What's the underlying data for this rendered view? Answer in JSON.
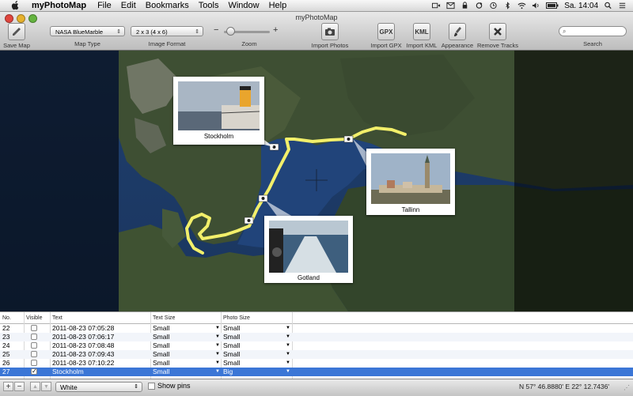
{
  "menubar": {
    "app_name": "myPhotoMap",
    "items": [
      "File",
      "Edit",
      "Bookmarks",
      "Tools",
      "Window",
      "Help"
    ],
    "clock": "Sa. 14:04"
  },
  "window": {
    "title": "myPhotoMap"
  },
  "toolbar": {
    "save_map": "Save Map",
    "map_type": {
      "label": "Map Type",
      "value": "NASA BlueMarble"
    },
    "image_format": {
      "label": "Image Format",
      "value": "2 x 3 (4 x 6)"
    },
    "zoom": {
      "label": "Zoom",
      "minus": "−",
      "plus": "+",
      "level": 0.15
    },
    "import_photos": "Import Photos",
    "import_gpx": "Import GPX",
    "gpx_icon_text": "GPX",
    "import_kml": "Import KML",
    "kml_icon_text": "KML",
    "appearance": "Appearance",
    "remove_tracks": "Remove Tracks",
    "search_label": "Search"
  },
  "map": {
    "photos": [
      {
        "caption": "Stockholm"
      },
      {
        "caption": "Tallinn"
      },
      {
        "caption": "Gotland"
      }
    ],
    "track_color": "#f2ef6a"
  },
  "table": {
    "headers": {
      "no": "No.",
      "visible": "Visible",
      "text": "Text",
      "text_size": "Text Size",
      "photo_size": "Photo Size"
    },
    "rows": [
      {
        "no": "22",
        "visible": false,
        "text": "2011-08-23 07:05:28",
        "text_size": "Small",
        "photo_size": "Small"
      },
      {
        "no": "23",
        "visible": false,
        "text": "2011-08-23 07:06:17",
        "text_size": "Small",
        "photo_size": "Small"
      },
      {
        "no": "24",
        "visible": false,
        "text": "2011-08-23 07:08:48",
        "text_size": "Small",
        "photo_size": "Small"
      },
      {
        "no": "25",
        "visible": false,
        "text": "2011-08-23 07:09:43",
        "text_size": "Small",
        "photo_size": "Small"
      },
      {
        "no": "26",
        "visible": false,
        "text": "2011-08-23 07:10:22",
        "text_size": "Small",
        "photo_size": "Small"
      },
      {
        "no": "27",
        "visible": true,
        "text": "Stockholm",
        "text_size": "Small",
        "photo_size": "Big"
      }
    ],
    "selected_color": "#3b76d6"
  },
  "bottombar": {
    "add": "+",
    "remove": "−",
    "up": "▲",
    "down": "▼",
    "color_value": "White",
    "show_pins_label": "Show pins",
    "coordinates": "N 57° 46.8880'  E 22° 12.7436'"
  }
}
